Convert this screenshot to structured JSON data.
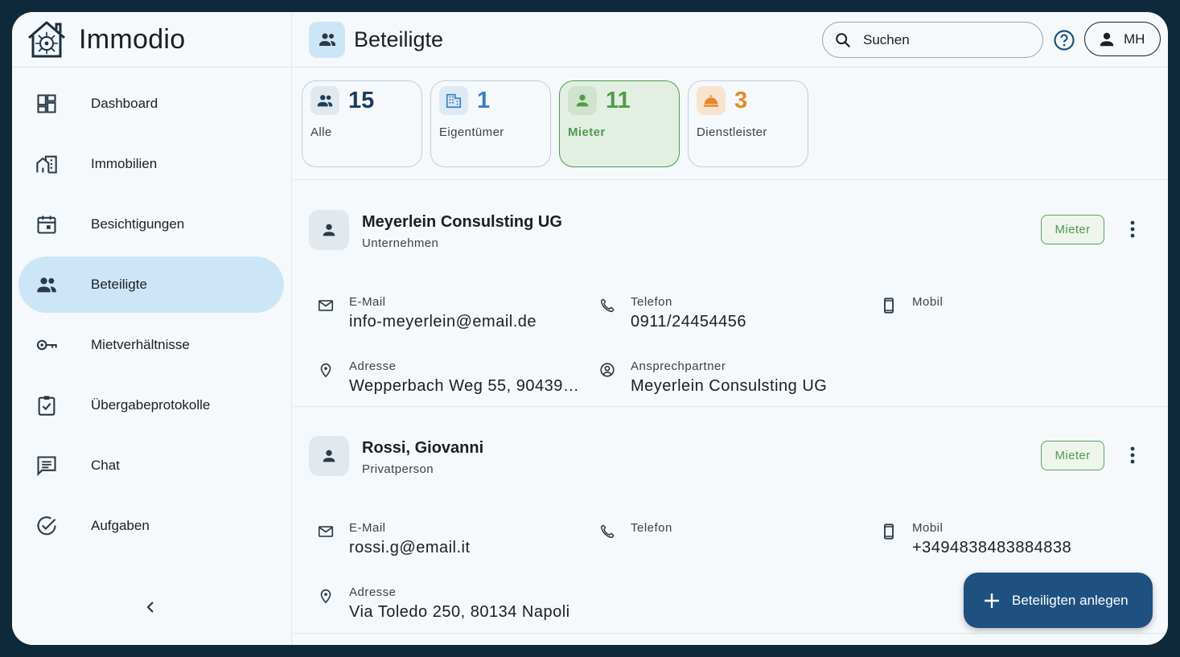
{
  "app": {
    "name": "Immodio"
  },
  "sidebar": {
    "items": [
      {
        "label": "Dashboard",
        "icon": "dashboard-icon"
      },
      {
        "label": "Immobilien",
        "icon": "building-icon"
      },
      {
        "label": "Besichtigungen",
        "icon": "calendar-icon"
      },
      {
        "label": "Beteiligte",
        "icon": "people-icon",
        "active": true
      },
      {
        "label": "Mietverhältnisse",
        "icon": "key-icon"
      },
      {
        "label": "Übergabeprotokolle",
        "icon": "clipboard-check-icon"
      },
      {
        "label": "Chat",
        "icon": "chat-icon"
      },
      {
        "label": "Aufgaben",
        "icon": "task-check-icon"
      }
    ]
  },
  "header": {
    "title": "Beteiligte",
    "search_placeholder": "Suchen",
    "user_initials": "MH"
  },
  "filters": [
    {
      "count": "15",
      "label": "Alle",
      "color": "#1b3d5a",
      "icon_bg": "#e1e8ee"
    },
    {
      "count": "1",
      "label": "Eigentümer",
      "color": "#3a7dc9",
      "icon_bg": "#dde9f5"
    },
    {
      "count": "11",
      "label": "Mieter",
      "color": "#4f9b4c",
      "icon_bg": "#cfe3cd",
      "active": true
    },
    {
      "count": "3",
      "label": "Dienstleister",
      "color": "#e38a2a",
      "icon_bg": "#f8e3cf"
    }
  ],
  "persons": [
    {
      "name": "Meyerlein Consulsting UG",
      "type": "Unternehmen",
      "role": "Mieter",
      "email_label": "E-Mail",
      "email": "info-meyerlein@email.de",
      "phone_label": "Telefon",
      "phone": "0911/24454456",
      "mobile_label": "Mobil",
      "mobile": "",
      "address_label": "Adresse",
      "address": "Wepperbach Weg 55, 90439 …",
      "contact_label": "Ansprechpartner",
      "contact": "Meyerlein Consulsting UG"
    },
    {
      "name": "Rossi, Giovanni",
      "type": "Privatperson",
      "role": "Mieter",
      "email_label": "E-Mail",
      "email": "rossi.g@email.it",
      "phone_label": "Telefon",
      "phone": "",
      "mobile_label": "Mobil",
      "mobile": "+3494838483884838",
      "address_label": "Adresse",
      "address": "Via Toledo 250, 80134 Napoli"
    }
  ],
  "fab": {
    "label": "Beteiligten anlegen"
  },
  "colors": {
    "accent": "#1e5080",
    "active_nav": "#cde6f7",
    "tenant_green": "#4f9b4c"
  }
}
